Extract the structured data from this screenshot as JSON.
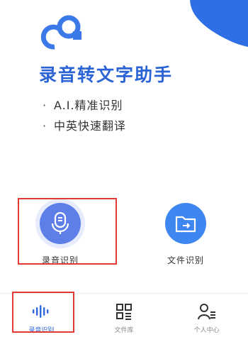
{
  "app": {
    "title": "录音转文字助手",
    "features": [
      "A.I.精准识别",
      "中英快速翻译"
    ],
    "feature_bullet": "·"
  },
  "actions": [
    {
      "label": "录音识别",
      "icon": "microphone-icon"
    },
    {
      "label": "文件识别",
      "icon": "folder-icon"
    }
  ],
  "tabs": [
    {
      "label": "录音识别",
      "icon": "waveform-icon",
      "active": true
    },
    {
      "label": "文件库",
      "icon": "grid-icon",
      "active": false
    },
    {
      "label": "个人中心",
      "icon": "user-icon",
      "active": false
    }
  ],
  "colors": {
    "brand": "#2a63d6",
    "accent": "#3e86f0",
    "highlight": "#e03a35"
  }
}
